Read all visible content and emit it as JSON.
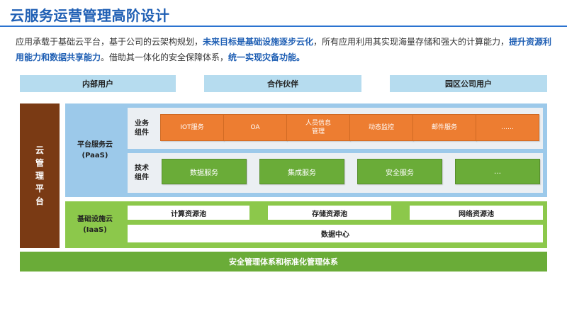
{
  "title": "云服务运营管理高阶设计",
  "intro": {
    "p1": "应用承载于基础云平台，基于公司的云架构规划，",
    "b1": "未来目标是基础设施逐步云化",
    "p2": "，所有应用利用其实现海量存储和强大的计算能力，",
    "b2": "提升资源利用能力和数据共享能力",
    "p3": "。借助其一体化的安全保障体系，",
    "b3": "统一实现灾备功能。"
  },
  "users": [
    "内部用户",
    "合作伙伴",
    "园区公司用户"
  ],
  "cloud_mgmt": [
    "云",
    "管",
    "理",
    "平",
    "台"
  ],
  "paas": {
    "label_line1": "平台服务云",
    "label_line2": "(PaaS)",
    "business": {
      "label_line1": "业务",
      "label_line2": "组件",
      "items": [
        "IOT服务",
        "OA",
        "人员信息管理",
        "动态监控",
        "邮件服务",
        "……"
      ]
    },
    "technical": {
      "label_line1": "技术",
      "label_line2": "组件",
      "items": [
        "数据服务",
        "集成服务",
        "安全服务",
        "…"
      ]
    }
  },
  "iaas": {
    "label_line1": "基础设施云",
    "label_line2": "(IaaS)",
    "pools": [
      "计算资源池",
      "存储资源池",
      "网络资源池"
    ],
    "datacenter": "数据中心"
  },
  "security_bar": "安全管理体系和标准化管理体系",
  "colors": {
    "title": "#1f5fb4",
    "user_box": "#b6dcef",
    "cloud_mgmt": "#7a3a14",
    "paas_bg": "#9cc9ea",
    "iaas_bg": "#8cc84b",
    "orange": "#ed7d31",
    "green": "#6aac38"
  }
}
